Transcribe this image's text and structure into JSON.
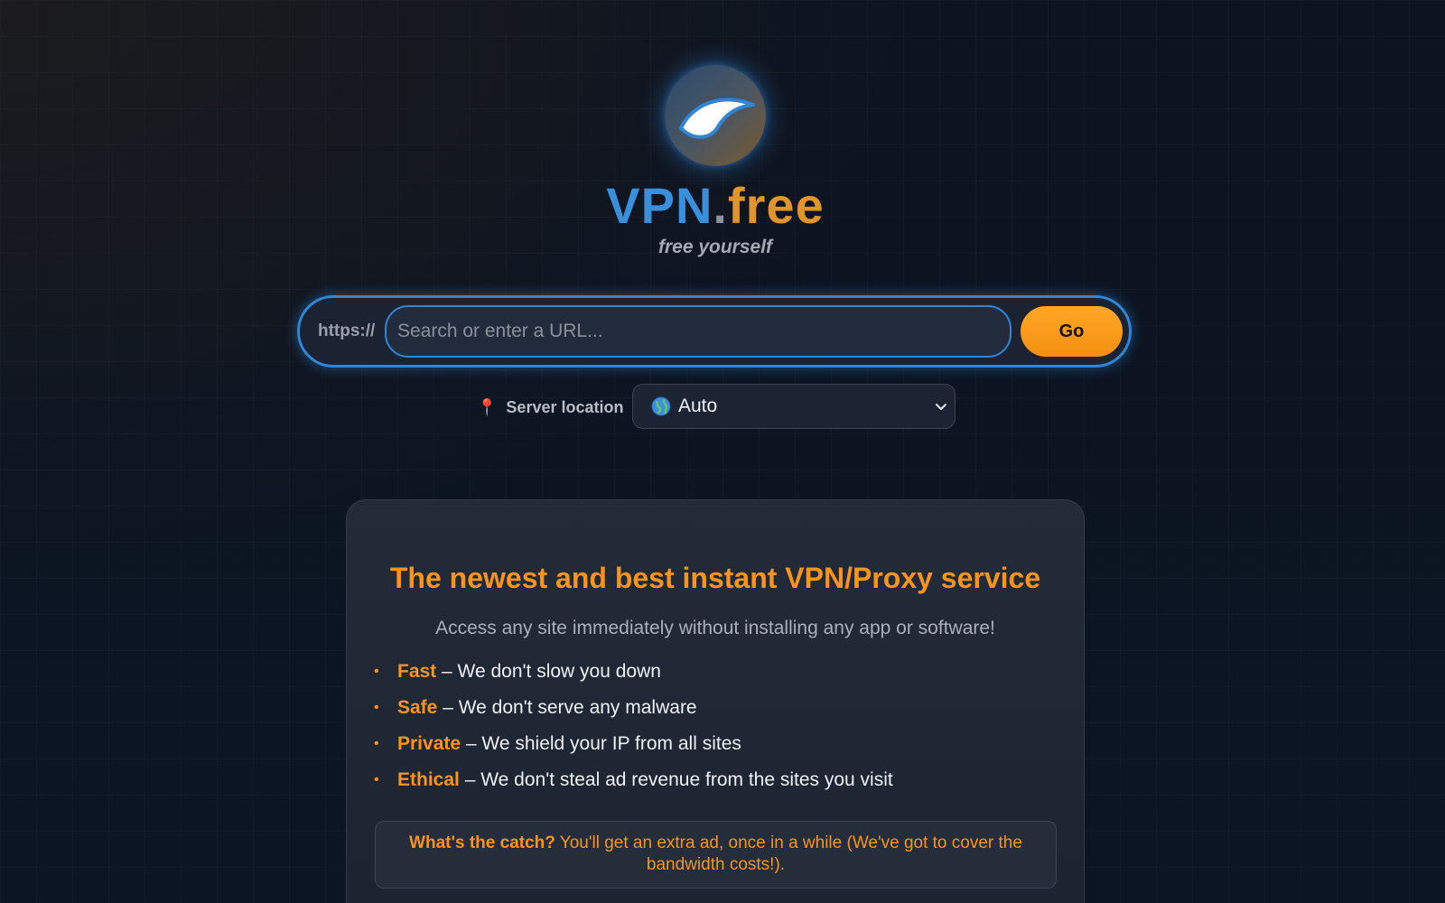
{
  "brand": {
    "name_part1": "VPN",
    "name_dot": ".",
    "name_part2": "free",
    "tagline": "free yourself",
    "logo_icon": "wing-logo-icon"
  },
  "search": {
    "prefix": "https://",
    "placeholder": "Search or enter a URL...",
    "value": "",
    "go_label": "Go"
  },
  "server_location": {
    "label": "Server location",
    "icon": "pin-icon",
    "selected": "Auto",
    "selected_icon": "globe-icon"
  },
  "info": {
    "title": "The newest and best instant VPN/Proxy service",
    "subtitle": "Access any site immediately without installing any app or software!",
    "features": [
      {
        "keyword": "Fast",
        "text": " – We don't slow you down"
      },
      {
        "keyword": "Safe",
        "text": " – We don't serve any malware"
      },
      {
        "keyword": "Private",
        "text": " – We shield your IP from all sites"
      },
      {
        "keyword": "Ethical",
        "text": " – We don't steal ad revenue from the sites you visit"
      }
    ],
    "catch_lead": "What's the catch?",
    "catch_text": " You'll get an extra ad, once in a while (We've got to cover the bandwidth costs!)."
  },
  "colors": {
    "accent_orange": "#f7941d",
    "accent_blue": "#2f85d6",
    "background": "#0c1320"
  }
}
